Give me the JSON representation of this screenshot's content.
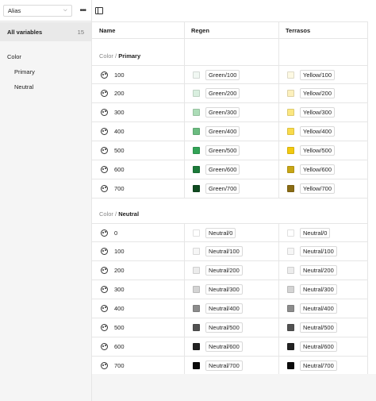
{
  "sidebar": {
    "mode_select": "Alias",
    "all_variables": {
      "label": "All variables",
      "count": "15"
    },
    "groups": [
      {
        "label": "Color",
        "children": [
          "Primary",
          "Neutral"
        ]
      }
    ]
  },
  "table": {
    "headers": {
      "name": "Name",
      "mode_a": "Regen",
      "mode_b": "Terrasos"
    },
    "sections": [
      {
        "path": "Color / ",
        "group": "Primary",
        "rows": [
          {
            "name": "100",
            "a": "Green/100",
            "a_color": "#f1f8f3",
            "b": "Yellow/100",
            "b_color": "#fdf9e3"
          },
          {
            "name": "200",
            "a": "Green/200",
            "a_color": "#d9efdf",
            "b": "Yellow/200",
            "b_color": "#fcf0bd"
          },
          {
            "name": "300",
            "a": "Green/300",
            "a_color": "#acdcb7",
            "b": "Yellow/300",
            "b_color": "#fbe680"
          },
          {
            "name": "400",
            "a": "Green/400",
            "a_color": "#6bbc80",
            "b": "Yellow/400",
            "b_color": "#f9da4a"
          },
          {
            "name": "500",
            "a": "Green/500",
            "a_color": "#33a457",
            "b": "Yellow/500",
            "b_color": "#f2c90f"
          },
          {
            "name": "600",
            "a": "Green/600",
            "a_color": "#1c7a3a",
            "b": "Yellow/600",
            "b_color": "#c8a615"
          },
          {
            "name": "700",
            "a": "Green/700",
            "a_color": "#0f4a20",
            "b": "Yellow/700",
            "b_color": "#8a6c14"
          }
        ]
      },
      {
        "path": "Color / ",
        "group": "Neutral",
        "rows": [
          {
            "name": "0",
            "a": "Neutral/0",
            "a_color": "#ffffff",
            "b": "Neutral/0",
            "b_color": "#ffffff"
          },
          {
            "name": "100",
            "a": "Neutral/100",
            "a_color": "#f6f6f6",
            "b": "Neutral/100",
            "b_color": "#f6f6f6"
          },
          {
            "name": "200",
            "a": "Neutral/200",
            "a_color": "#ececec",
            "b": "Neutral/200",
            "b_color": "#ececec"
          },
          {
            "name": "300",
            "a": "Neutral/300",
            "a_color": "#d4d4d4",
            "b": "Neutral/300",
            "b_color": "#d4d4d4"
          },
          {
            "name": "400",
            "a": "Neutral/400",
            "a_color": "#8c8c8c",
            "b": "Neutral/400",
            "b_color": "#8c8c8c"
          },
          {
            "name": "500",
            "a": "Neutral/500",
            "a_color": "#515151",
            "b": "Neutral/500",
            "b_color": "#515151"
          },
          {
            "name": "600",
            "a": "Neutral/600",
            "a_color": "#222222",
            "b": "Neutral/600",
            "b_color": "#222222"
          },
          {
            "name": "700",
            "a": "Neutral/700",
            "a_color": "#0a0a0a",
            "b": "Neutral/700",
            "b_color": "#0a0a0a"
          }
        ]
      }
    ]
  },
  "icons": {
    "more": "more-horizontal-icon",
    "panel": "sidebar-toggle-icon",
    "variable": "palette-icon"
  }
}
